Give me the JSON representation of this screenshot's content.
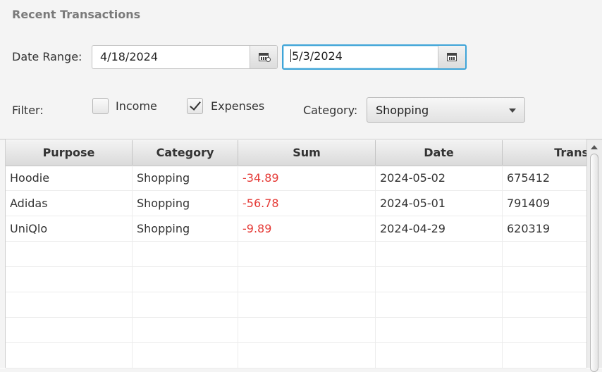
{
  "title": "Recent Transactions",
  "date_range": {
    "label": "Date Range:",
    "start": "4/18/2024",
    "end": "5/3/2024",
    "calendar_icon": "calendar-icon"
  },
  "filter": {
    "label": "Filter:",
    "income": {
      "label": "Income",
      "checked": false
    },
    "expenses": {
      "label": "Expenses",
      "checked": true
    }
  },
  "category": {
    "label": "Category:",
    "selected": "Shopping"
  },
  "table": {
    "columns": [
      "Purpose",
      "Category",
      "Sum",
      "Date",
      "Trans"
    ],
    "rows": [
      {
        "purpose": "Hoodie",
        "category": "Shopping",
        "sum": "-34.89",
        "date": "2024-05-02",
        "trans": "675412"
      },
      {
        "purpose": "Adidas",
        "category": "Shopping",
        "sum": "-56.78",
        "date": "2024-05-01",
        "trans": "791409"
      },
      {
        "purpose": "UniQlo",
        "category": "Shopping",
        "sum": "-9.89",
        "date": "2024-04-29",
        "trans": "620319"
      }
    ]
  },
  "colors": {
    "negative": "#e53935",
    "focus": "#3ea4d8"
  }
}
